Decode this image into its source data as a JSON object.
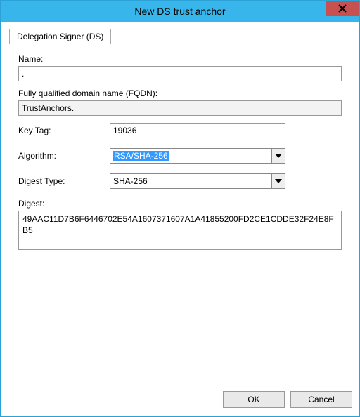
{
  "window": {
    "title": "New DS trust anchor"
  },
  "tab": {
    "label": "Delegation Signer (DS)"
  },
  "name_section": {
    "label": "Name:",
    "value": "."
  },
  "fqdn_section": {
    "label": "Fully qualified domain name (FQDN):",
    "value": "TrustAnchors."
  },
  "key_tag": {
    "label": "Key Tag:",
    "value": "19036"
  },
  "algorithm": {
    "label": "Algorithm:",
    "value": "RSA/SHA-256"
  },
  "digest_type": {
    "label": "Digest Type:",
    "value": "SHA-256"
  },
  "digest": {
    "label": "Digest:",
    "value": "49AAC11D7B6F6446702E54A1607371607A1A41855200FD2CE1CDDE32F24E8FB5"
  },
  "buttons": {
    "ok": "OK",
    "cancel": "Cancel"
  }
}
